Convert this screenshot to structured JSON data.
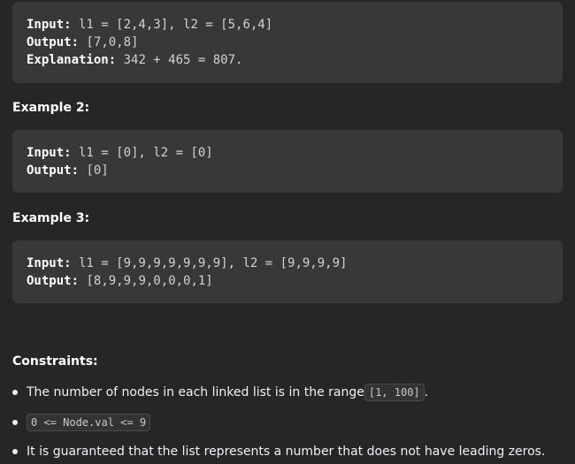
{
  "example1": {
    "input_label": "Input:",
    "input_value": " l1 = [2,4,3], l2 = [5,6,4]",
    "output_label": "Output:",
    "output_value": " [7,0,8]",
    "explanation_label": "Explanation:",
    "explanation_value": " 342 + 465 = 807."
  },
  "example2": {
    "heading": "Example 2:",
    "input_label": "Input:",
    "input_value": " l1 = [0], l2 = [0]",
    "output_label": "Output:",
    "output_value": " [0]"
  },
  "example3": {
    "heading": "Example 3:",
    "input_label": "Input:",
    "input_value": " l1 = [9,9,9,9,9,9,9], l2 = [9,9,9,9]",
    "output_label": "Output:",
    "output_value": " [8,9,9,9,0,0,0,1]"
  },
  "constraints": {
    "heading": "Constraints:",
    "item1_text": "The number of nodes in each linked list is in the range ",
    "item1_code": "[1, 100]",
    "item1_suffix": ".",
    "item2_code": "0 <= Node.val <= 9",
    "item3_text": "It is guaranteed that the list represents a number that does not have leading zeros."
  }
}
